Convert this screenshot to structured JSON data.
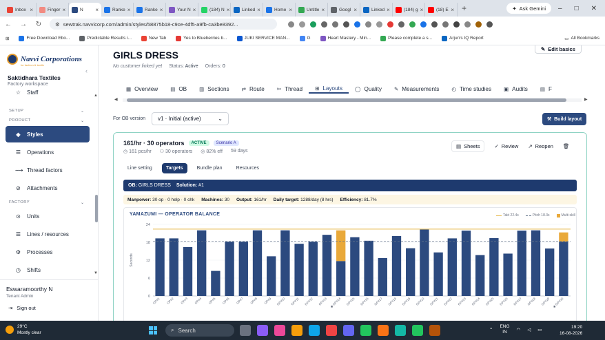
{
  "browser": {
    "tabs": [
      {
        "label": "Inbox",
        "color": "#ea4335"
      },
      {
        "label": "Finger",
        "color": "#f28b82"
      },
      {
        "label": "N",
        "color": "#2c4a7f",
        "active": true
      },
      {
        "label": "Ranke",
        "color": "#1a73e8"
      },
      {
        "label": "Ranke",
        "color": "#1a73e8"
      },
      {
        "label": "Your N",
        "color": "#7e57c2"
      },
      {
        "label": "(184) N",
        "color": "#25d366"
      },
      {
        "label": "Linked",
        "color": "#0a66c2"
      },
      {
        "label": "Home",
        "color": "#1a73e8"
      },
      {
        "label": "Untitle",
        "color": "#34a853"
      },
      {
        "label": "Googl",
        "color": "#5f6368"
      },
      {
        "label": "Linked",
        "color": "#0a66c2"
      },
      {
        "label": "(184) g",
        "color": "#ff0000"
      },
      {
        "label": "(18) E",
        "color": "#ff0000"
      }
    ],
    "new_tab": "+",
    "gemini_label": "Ask Gemini",
    "url": "sewtrak.navvicorp.com/admin/styles/58875b18-c9ce-4df5-a9fb-ca3be8392...",
    "bookmarks": [
      "Free Download Ebo...",
      "Predictable Results i...",
      "New Tab",
      "Yes to Blueberries b...",
      "JUKI SERVICE MAN...",
      "G",
      "Heart Mastery - Min...",
      "Please complete a s...",
      "Arjun's IQ Report"
    ],
    "all_bookmarks": "All Bookmarks"
  },
  "sidebar": {
    "brand": "Navvi Corporations",
    "tagline": "for fashion & textile",
    "company": "Saktidhara Textiles",
    "workspace": "Factory workspace",
    "items_top": [
      {
        "label": "Staff",
        "icon": "star-icon"
      }
    ],
    "section_setup": "SETUP",
    "section_product": "PRODUCT",
    "product_items": [
      {
        "label": "Styles",
        "icon": "tag-icon",
        "active": true
      },
      {
        "label": "Operations",
        "icon": "list-icon"
      },
      {
        "label": "Thread factors",
        "icon": "thread-icon"
      },
      {
        "label": "Attachments",
        "icon": "attachment-icon"
      }
    ],
    "section_factory": "FACTORY",
    "factory_items": [
      {
        "label": "Units",
        "icon": "pin-icon"
      },
      {
        "label": "Lines / resources",
        "icon": "list-icon"
      },
      {
        "label": "Processes",
        "icon": "gear-icon"
      },
      {
        "label": "Shifts",
        "icon": "clock-icon"
      }
    ],
    "user_name": "Eswaramoorthy N",
    "user_role": "Tenant Admin",
    "sign_out": "Sign out"
  },
  "header": {
    "title": "GIRLS DRESS",
    "edit_basics": "Edit basics",
    "customer": "No customer linked yet",
    "status_label": "Status:",
    "status_value": "Active",
    "orders_label": "Orders:",
    "orders_value": "0"
  },
  "tabs": [
    {
      "label": "Overview",
      "icon": "grid-icon"
    },
    {
      "label": "OB",
      "icon": "doc-icon"
    },
    {
      "label": "Sections",
      "icon": "sections-icon"
    },
    {
      "label": "Route",
      "icon": "route-icon"
    },
    {
      "label": "Thread",
      "icon": "thread-icon"
    },
    {
      "label": "Layouts",
      "icon": "layouts-icon",
      "active": true
    },
    {
      "label": "Quality",
      "icon": "shield-icon"
    },
    {
      "label": "Measurements",
      "icon": "ruler-icon"
    },
    {
      "label": "Time studies",
      "icon": "stopwatch-icon"
    },
    {
      "label": "Audits",
      "icon": "audit-icon"
    },
    {
      "label": "F",
      "icon": "doc-icon"
    }
  ],
  "ob_version": {
    "label": "For OB version",
    "selected": "v1 · Initial (active)"
  },
  "build_layout": "Build layout",
  "layout": {
    "title": "161/hr · 30 operators",
    "badge_status": "ACTIVE",
    "badge_scenario": "Scenario A",
    "stats": [
      "161 pcs/hr",
      "30 operators",
      "82% eff",
      "59 days"
    ],
    "actions": {
      "sheets": "Sheets",
      "review": "Review",
      "reopen": "Reopen"
    },
    "subtabs": [
      {
        "label": "Line setting"
      },
      {
        "label": "Targets",
        "active": true
      },
      {
        "label": "Bundle plan"
      },
      {
        "label": "Resources"
      }
    ],
    "banner": {
      "ob_label": "OB:",
      "ob_value": "GIRLS DRESS",
      "sol_label": "Solution:",
      "sol_value": "#1"
    },
    "summary": {
      "manpower_label": "Manpower:",
      "manpower_value": "30 op · 0 help · 0 chk",
      "machines_label": "Machines:",
      "machines_value": "30",
      "output_label": "Output:",
      "output_value": "161/hr",
      "daily_label": "Daily target:",
      "daily_value": "1288/day (8 hrs)",
      "eff_label": "Efficiency:",
      "eff_value": "81.7%"
    }
  },
  "chart_data": {
    "type": "bar",
    "title": "YAMAZUMI — OPERATOR BALANCE",
    "ylabel": "Seconds",
    "ylim": [
      0,
      24
    ],
    "yticks": [
      0,
      6,
      12,
      18,
      24
    ],
    "legend": [
      {
        "label": "Takt 22.4s",
        "style": "line",
        "color": "#e5b84a"
      },
      {
        "label": "Pitch 18.3s",
        "style": "dashed",
        "color": "#64748b"
      },
      {
        "label": "Multi skill",
        "style": "square",
        "color": "#e9a93a"
      }
    ],
    "takt": 22.4,
    "pitch": 18.3,
    "categories": [
      "OP#1",
      "OP#2",
      "OP#3",
      "OP#4",
      "OP#5",
      "OP#6",
      "OP#7",
      "OP#8",
      "OP#9",
      "OP#10",
      "OP#11",
      "OP#12",
      "OP#13",
      "OP#14",
      "OP#15",
      "OP#16",
      "OP#17",
      "OP#18",
      "OP#19",
      "OP#20",
      "OP#21",
      "OP#22",
      "OP#23",
      "OP#24",
      "OP#25",
      "OP#26",
      "OP#27",
      "OP#28",
      "OP#29",
      "OP#30"
    ],
    "multi_skill_flags": [
      false,
      false,
      false,
      false,
      false,
      false,
      false,
      false,
      false,
      false,
      false,
      false,
      false,
      true,
      false,
      false,
      false,
      false,
      false,
      false,
      false,
      false,
      false,
      false,
      false,
      false,
      false,
      false,
      false,
      true
    ],
    "series": [
      {
        "key": "base",
        "color": "#2c4a7f",
        "values": [
          19.3,
          19.3,
          16.4,
          22.0,
          8.4,
          18.2,
          18.2,
          22.0,
          13.3,
          22.0,
          17.5,
          18.2,
          20.5,
          11.7,
          19.7,
          18.5,
          12.7,
          20.1,
          16.0,
          22.3,
          14.6,
          19.3,
          21.9,
          13.7,
          19.4,
          14.2,
          21.9,
          22.0,
          15.9,
          18.2
        ],
        "labels": [
          "",
          "",
          "",
          "",
          "",
          "",
          "",
          "",
          "",
          "",
          "",
          "",
          "",
          "",
          "",
          "",
          "",
          "",
          "",
          "",
          "",
          "",
          "",
          "",
          "",
          "",
          "",
          "",
          "",
          ""
        ]
      },
      {
        "key": "multi",
        "color": "#e9a93a",
        "values": [
          0,
          0,
          0,
          0,
          0,
          0,
          0,
          0,
          0,
          0,
          0,
          0,
          0,
          10.3,
          0,
          0,
          0,
          0,
          0,
          0,
          0,
          0,
          0,
          0,
          0,
          0,
          0,
          0,
          0,
          3.1
        ]
      }
    ]
  },
  "taskbar": {
    "temp": "29°C",
    "weather": "Mostly clear",
    "search": "Search",
    "lang1": "ENG",
    "lang2": "IN",
    "time": "19:20",
    "date": "16-08-2026"
  }
}
